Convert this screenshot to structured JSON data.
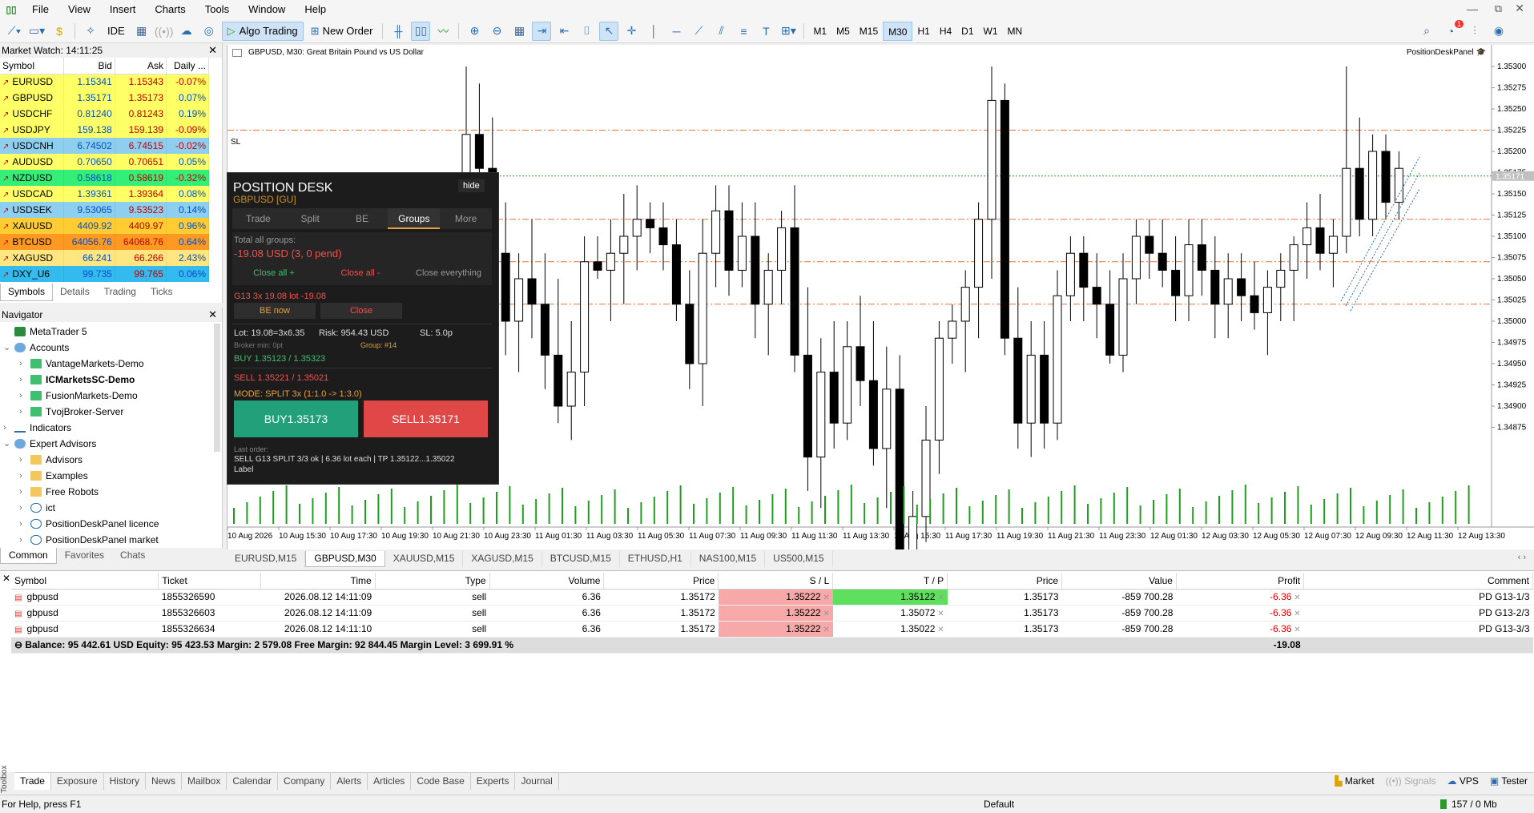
{
  "menu": [
    "File",
    "View",
    "Insert",
    "Charts",
    "Tools",
    "Window",
    "Help"
  ],
  "toolbar": {
    "algo_label": "Algo Trading",
    "neworder_label": "New Order",
    "ide_label": "IDE",
    "timeframes": [
      "M1",
      "M5",
      "M15",
      "M30",
      "H1",
      "H4",
      "D1",
      "W1",
      "MN"
    ],
    "active_tf": "M30"
  },
  "market_watch": {
    "title": "Market Watch: 14:11:25",
    "headers": [
      "Symbol",
      "Bid",
      "Ask",
      "Daily ..."
    ],
    "rows": [
      {
        "sym": "EURUSD",
        "bid": "1.15341",
        "ask": "1.15343",
        "daily": "-0.07%",
        "bg": "#ffff66"
      },
      {
        "sym": "GBPUSD",
        "bid": "1.35171",
        "ask": "1.35173",
        "daily": "0.07%",
        "bg": "#ffff66"
      },
      {
        "sym": "USDCHF",
        "bid": "0.81240",
        "ask": "0.81243",
        "daily": "0.19%",
        "bg": "#ffff66"
      },
      {
        "sym": "USDJPY",
        "bid": "159.138",
        "ask": "159.139",
        "daily": "-0.09%",
        "bg": "#ffff66"
      },
      {
        "sym": "USDCNH",
        "bid": "6.74502",
        "ask": "6.74515",
        "daily": "-0.02%",
        "bg": "#8ecfef"
      },
      {
        "sym": "AUDUSD",
        "bid": "0.70650",
        "ask": "0.70651",
        "daily": "0.05%",
        "bg": "#ffff66"
      },
      {
        "sym": "NZDUSD",
        "bid": "0.58618",
        "ask": "0.58619",
        "daily": "-0.32%",
        "bg": "#33ee77"
      },
      {
        "sym": "USDCAD",
        "bid": "1.39361",
        "ask": "1.39364",
        "daily": "0.08%",
        "bg": "#ffff66"
      },
      {
        "sym": "USDSEK",
        "bid": "9.53065",
        "ask": "9.53523",
        "daily": "0.14%",
        "bg": "#8ecfef"
      },
      {
        "sym": "XAUUSD",
        "bid": "4409.92",
        "ask": "4409.97",
        "daily": "0.96%",
        "bg": "#ffcc33"
      },
      {
        "sym": "BTCUSD",
        "bid": "64056.76",
        "ask": "64068.76",
        "daily": "0.64%",
        "bg": "#ff9922"
      },
      {
        "sym": "XAGUSD",
        "bid": "66.241",
        "ask": "66.266",
        "daily": "2.43%",
        "bg": "#ffe680"
      },
      {
        "sym": "DXY_U6",
        "bid": "99.735",
        "ask": "99.765",
        "daily": "0.06%",
        "bg": "#33bbee"
      }
    ],
    "tabs": [
      "Symbols",
      "Details",
      "Trading",
      "Ticks"
    ]
  },
  "navigator": {
    "title": "Navigator",
    "items": [
      {
        "label": "MetaTrader 5",
        "level": 0
      },
      {
        "label": "Accounts",
        "level": 0
      },
      {
        "label": "VantageMarkets-Demo",
        "level": 1
      },
      {
        "label": "ICMarketsSC-Demo",
        "level": 1
      },
      {
        "label": "FusionMarkets-Demo",
        "level": 1
      },
      {
        "label": "TvojBroker-Server",
        "level": 1
      },
      {
        "label": "Indicators",
        "level": 0
      },
      {
        "label": "Expert Advisors",
        "level": 0
      },
      {
        "label": "Advisors",
        "level": 1
      },
      {
        "label": "Examples",
        "level": 1
      },
      {
        "label": "Free Robots",
        "level": 1
      },
      {
        "label": "ict",
        "level": 1
      },
      {
        "label": "PositionDeskPanel licence",
        "level": 1
      },
      {
        "label": "PositionDeskPanel market",
        "level": 1
      }
    ],
    "tabs": [
      "Common",
      "Favorites",
      "Chats"
    ]
  },
  "chart": {
    "title": "GBPUSD, M30:  Great Britain Pound vs US Dollar",
    "panel_label": "PositionDeskPanel",
    "sl_label": "SL",
    "price_label": "1.35171",
    "y_ticks": [
      "1.35300",
      "1.35275",
      "1.35250",
      "1.35225",
      "1.35200",
      "1.35175",
      "1.35150",
      "1.35125",
      "1.35100",
      "1.35075",
      "1.35050",
      "1.35025",
      "1.35000",
      "1.34975",
      "1.34950",
      "1.34925",
      "1.34900",
      "1.34875"
    ],
    "x_ticks": [
      "10 Aug 2026",
      "10 Aug 15:30",
      "10 Aug 17:30",
      "10 Aug 19:30",
      "10 Aug 21:30",
      "10 Aug 23:30",
      "11 Aug 01:30",
      "11 Aug 03:30",
      "11 Aug 05:30",
      "11 Aug 07:30",
      "11 Aug 09:30",
      "11 Aug 11:30",
      "11 Aug 13:30",
      "11 Aug 15:30",
      "11 Aug 17:30",
      "11 Aug 19:30",
      "11 Aug 21:30",
      "11 Aug 23:30",
      "12 Aug 01:30",
      "12 Aug 03:30",
      "12 Aug 05:30",
      "12 Aug 07:30",
      "12 Aug 09:30",
      "12 Aug 11:30",
      "12 Aug 13:30"
    ],
    "tabs": [
      "EURUSD,M15",
      "GBPUSD,M30",
      "XAUUSD,M15",
      "XAGUSD,M15",
      "BTCUSD,M15",
      "ETHUSD,H1",
      "NAS100,M15",
      "US500,M15"
    ],
    "active_tab": "GBPUSD,M30"
  },
  "position_desk": {
    "title": "POSITION DESK",
    "subtitle": "GBPUSD  [GU]",
    "hide_label": "hide",
    "tabs": [
      "Trade",
      "Split",
      "BE",
      "Groups",
      "More"
    ],
    "active_tab": "Groups",
    "total_label": "Total all groups:",
    "total_value": "-19.08 USD  (3, 0 pend)",
    "close_all_plus": "Close all +",
    "close_all_minus": "Close all -",
    "close_everything": "Close everything",
    "group_line": "G13  3x  19.08 lot  -19.08",
    "be_now": "BE now",
    "close": "Close",
    "lot_line": "Lot: 19.08=3x6.35",
    "risk_line": "Risk: 954.43 USD",
    "sl_line": "SL: 5.0p",
    "broker_min": "Broker min: 0pt",
    "group_num": "Group: #14",
    "buy_line": "BUY  1.35123 / 1.35323",
    "sell_line": "SELL  1.35221 / 1.35021",
    "mode_line": "MODE: SPLIT 3x (1:1.0 -> 1:3.0)",
    "buy_btn": "BUY1.35173",
    "sell_btn": "SELL1.35171",
    "last_order_label": "Last order:",
    "last_order": "SELL G13 SPLIT 3/3 ok | 6.36 lot each | TP 1.35122...1.35022",
    "label": "Label"
  },
  "trade_table": {
    "headers": [
      "Symbol",
      "Ticket",
      "Time",
      "Type",
      "Volume",
      "Price",
      "S / L",
      "T / P",
      "Price",
      "Value",
      "Profit",
      "Comment"
    ],
    "rows": [
      {
        "symbol": "gbpusd",
        "ticket": "1855326590",
        "time": "2026.08.12 14:11:09",
        "type": "sell",
        "volume": "6.36",
        "price": "1.35172",
        "sl": "1.35222",
        "tp": "1.35122",
        "cur": "1.35173",
        "value": "-859 700.28",
        "profit": "-6.36",
        "comment": "PD G13-1/3",
        "tp_hl": true
      },
      {
        "symbol": "gbpusd",
        "ticket": "1855326603",
        "time": "2026.08.12 14:11:09",
        "type": "sell",
        "volume": "6.36",
        "price": "1.35172",
        "sl": "1.35222",
        "tp": "1.35072",
        "cur": "1.35173",
        "value": "-859 700.28",
        "profit": "-6.36",
        "comment": "PD G13-2/3",
        "tp_hl": false
      },
      {
        "symbol": "gbpusd",
        "ticket": "1855326634",
        "time": "2026.08.12 14:11:10",
        "type": "sell",
        "volume": "6.36",
        "price": "1.35172",
        "sl": "1.35222",
        "tp": "1.35022",
        "cur": "1.35173",
        "value": "-859 700.28",
        "profit": "-6.36",
        "comment": "PD G13-3/3",
        "tp_hl": false
      }
    ],
    "balance_line": "Balance: 95 442.61 USD  Equity: 95 423.53  Margin: 2 579.08  Free Margin: 92 844.45  Margin Level: 3 699.91 %",
    "total_profit": "-19.08"
  },
  "bottom_tabs": [
    "Trade",
    "Exposure",
    "History",
    "News",
    "Mailbox",
    "Calendar",
    "Company",
    "Alerts",
    "Articles",
    "Code Base",
    "Experts",
    "Journal"
  ],
  "bottom_right": {
    "market": "Market",
    "signals": "Signals",
    "vps": "VPS",
    "tester": "Tester"
  },
  "toolbox_label": "Toolbox",
  "status": {
    "help": "For Help, press F1",
    "profile": "Default",
    "traffic": "157 / 0 Mb"
  },
  "notification_count": "1"
}
